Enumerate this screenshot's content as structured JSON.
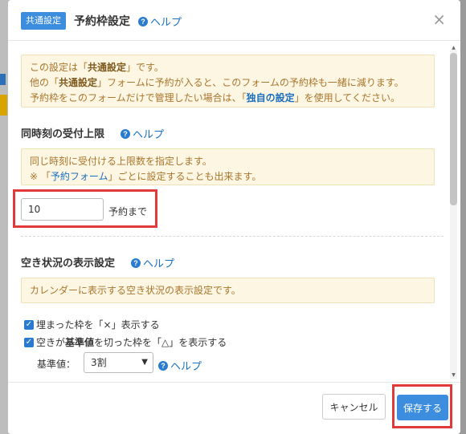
{
  "header": {
    "badge": "共通設定",
    "title": "予約枠設定",
    "help": "ヘルプ",
    "close": "×"
  },
  "notice_common": {
    "l1_a": "この設定は「",
    "l1_b": "共通設定",
    "l1_c": "」です。",
    "l2_a": "他の「",
    "l2_b": "共通設定",
    "l2_c": "」フォームに予約が入ると、このフォームの予約枠も一緒に減ります。",
    "l3_a": "予約枠をこのフォームだけで管理したい場合は、「",
    "l3_b": "独自の設定",
    "l3_c": "」を使用してください。"
  },
  "capacity": {
    "title": "同時刻の受付上限",
    "help": "ヘルプ",
    "note1": "同じ時刻に受付ける上限数を指定します。",
    "note2_a": "※ 「",
    "note2_b": "予約フォーム",
    "note2_c": "」ごとに設定することも出来ます。",
    "value": "10",
    "suffix": "予約まで"
  },
  "availability": {
    "title": "空き状況の表示設定",
    "help": "ヘルプ",
    "note": "カレンダーに表示する空き状況の表示設定です。",
    "cb1": "埋まった枠を「×」表示する",
    "cb2_a": "空きが",
    "cb2_b": "基準値",
    "cb2_c": "を切った枠を「△」を表示する",
    "ref_label": "基準値：",
    "ref_value": "3割",
    "ref_help": "ヘルプ"
  },
  "footer": {
    "cancel": "キャンセル",
    "save": "保存する"
  },
  "colors": {
    "accent": "#3c8dde",
    "highlight": "#e03a3a"
  }
}
